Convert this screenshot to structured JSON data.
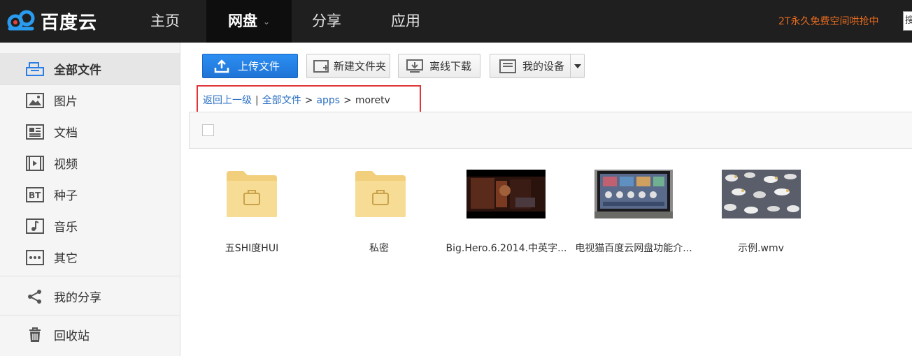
{
  "logo": {
    "text": "百度云"
  },
  "nav": {
    "items": [
      {
        "label": "主页"
      },
      {
        "label": "网盘"
      },
      {
        "label": "分享"
      },
      {
        "label": "应用"
      }
    ],
    "caret_icon": "chevron-down-icon",
    "promo": "2T永久免费空间哄抢中",
    "search_stub": "搜"
  },
  "sidebar": {
    "items": [
      {
        "label": "全部文件",
        "icon": "all-files-icon"
      },
      {
        "label": "图片",
        "icon": "picture-icon"
      },
      {
        "label": "文档",
        "icon": "document-icon"
      },
      {
        "label": "视频",
        "icon": "video-icon"
      },
      {
        "label": "种子",
        "icon": "torrent-icon"
      },
      {
        "label": "音乐",
        "icon": "music-icon"
      },
      {
        "label": "其它",
        "icon": "other-icon"
      },
      {
        "label": "我的分享",
        "icon": "share-icon"
      },
      {
        "label": "回收站",
        "icon": "trash-icon"
      }
    ]
  },
  "toolbar": {
    "upload": "上传文件",
    "new_folder": "新建文件夹",
    "offline_download": "离线下载",
    "my_devices": "我的设备"
  },
  "breadcrumb": {
    "back": "返回上一级",
    "divider": "|",
    "root": "全部文件",
    "arrow": ">",
    "level1": "apps",
    "current": "moretv"
  },
  "files": [
    {
      "name": "五SHI度HUI",
      "type": "folder"
    },
    {
      "name": "私密",
      "type": "folder"
    },
    {
      "name": "Big.Hero.6.2014.中英字...",
      "type": "video"
    },
    {
      "name": "电视猫百度云网盘功能介...",
      "type": "video"
    },
    {
      "name": "示例.wmv",
      "type": "video"
    }
  ],
  "colors": {
    "topbar": "#1f1f1f",
    "accent_blue": "#2a7ee6",
    "promo_orange": "#e66b1f",
    "highlight_red": "#e0363a",
    "folder_yellow": "#f7d98b"
  }
}
